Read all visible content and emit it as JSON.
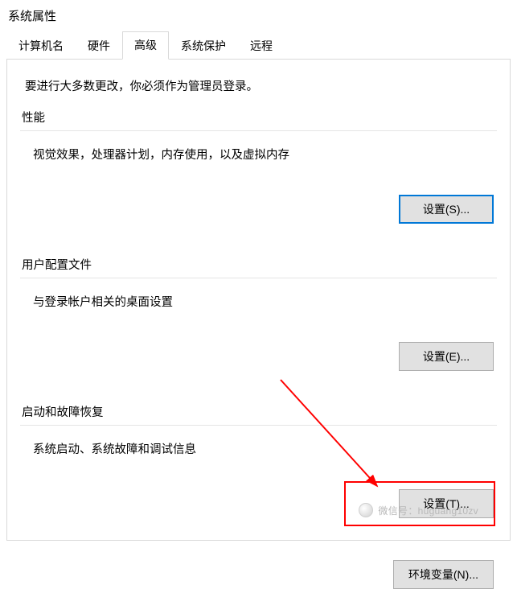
{
  "window": {
    "title": "系统属性"
  },
  "tabs": {
    "computer_name": "计算机名",
    "hardware": "硬件",
    "advanced": "高级",
    "system_protection": "系统保护",
    "remote": "远程"
  },
  "panel": {
    "intro": "要进行大多数更改，你必须作为管理员登录。"
  },
  "performance": {
    "title": "性能",
    "desc": "视觉效果，处理器计划，内存使用，以及虚拟内存",
    "button": "设置(S)..."
  },
  "user_profiles": {
    "title": "用户配置文件",
    "desc": "与登录帐户相关的桌面设置",
    "button": "设置(E)..."
  },
  "startup": {
    "title": "启动和故障恢复",
    "desc": "系统启动、系统故障和调试信息",
    "button": "设置(T)..."
  },
  "env": {
    "button": "环境变量(N)..."
  },
  "watermark": {
    "text": "微信号：huguang10zv"
  }
}
